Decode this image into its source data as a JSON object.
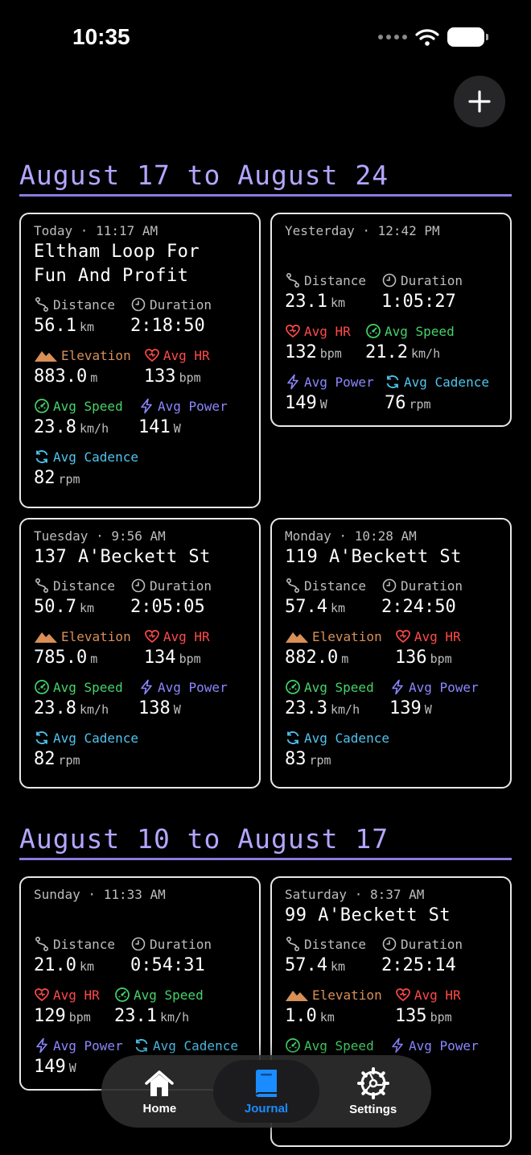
{
  "status_bar": {
    "time": "10:35"
  },
  "sections": [
    {
      "title": "August 17 to August 24",
      "cards": [
        {
          "date": "Today · 11:17 AM",
          "title_lines": [
            "Eltham Loop For",
            "Fun And Profit"
          ],
          "distance": "56.1",
          "duration": "2:18:50",
          "elevation": "883.0",
          "avg_hr": "133",
          "avg_speed": "23.8",
          "avg_power": "141",
          "avg_cadence": "82"
        },
        {
          "date": "Yesterday · 12:42 PM",
          "title_lines": [],
          "distance": "23.1",
          "duration": "1:05:27",
          "avg_hr": "132",
          "avg_speed": "21.2",
          "avg_power": "149",
          "avg_cadence": "76"
        },
        {
          "date": "Tuesday · 9:56 AM",
          "title_lines": [
            "137 A'Beckett St"
          ],
          "distance": "50.7",
          "duration": "2:05:05",
          "elevation": "785.0",
          "avg_hr": "134",
          "avg_speed": "23.8",
          "avg_power": "138",
          "avg_cadence": "82"
        },
        {
          "date": "Monday · 10:28 AM",
          "title_lines": [
            "119 A'Beckett St"
          ],
          "distance": "57.4",
          "duration": "2:24:50",
          "elevation": "882.0",
          "avg_hr": "136",
          "avg_speed": "23.3",
          "avg_power": "139",
          "avg_cadence": "83"
        }
      ]
    },
    {
      "title": "August 10 to August 17",
      "cards": [
        {
          "date": "Sunday · 11:33 AM",
          "title_lines": [],
          "distance": "21.0",
          "duration": "0:54:31",
          "avg_hr": "129",
          "avg_speed": "23.1",
          "avg_power": "149"
        },
        {
          "date": "Saturday · 8:37 AM",
          "title_lines": [
            "99 A'Beckett St"
          ],
          "distance": "57.4",
          "duration": "2:25:14",
          "elevation": "1.0",
          "elevation_unit": "km",
          "avg_hr": "135",
          "avg_speed": "",
          "avg_power": ""
        }
      ]
    }
  ],
  "labels": {
    "distance": "Distance",
    "duration": "Duration",
    "elevation": "Elevation",
    "avg_hr": "Avg HR",
    "avg_speed": "Avg Speed",
    "avg_power": "Avg Power",
    "avg_cadence": "Avg Cadence"
  },
  "units": {
    "km": "km",
    "m": "m",
    "bpm": "bpm",
    "kmh": "km/h",
    "w": "W",
    "rpm": "rpm"
  },
  "tab_bar": {
    "tabs": [
      {
        "label": "Home",
        "icon": "house-icon",
        "active": false
      },
      {
        "label": "Journal",
        "icon": "book-icon",
        "active": true
      },
      {
        "label": "Settings",
        "icon": "gear-icon",
        "active": false
      }
    ]
  },
  "colors": {
    "accent": "#8a7be0",
    "section_title": "#b3a6ff",
    "elevation": "#d88f58",
    "hr": "#ff4a4a",
    "speed": "#45d36a",
    "power": "#8c86ff",
    "cadence": "#4fc4ef",
    "tab_active": "#1a8cff"
  }
}
